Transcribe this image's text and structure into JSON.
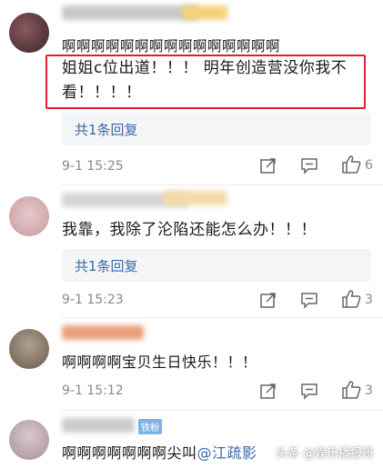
{
  "comments": [
    {
      "body_line1": "啊啊啊啊啊啊啊啊啊啊啊啊啊啊啊",
      "body_line2": "姐姐c位出道！！！ 明年创造营没你我不",
      "body_line3": "看！！！！",
      "reply_label": "共1条回复",
      "time": "9-1 15:25",
      "likes": "6"
    },
    {
      "body": "我靠，我除了沦陷还能怎么办！！！",
      "reply_label": "共1条回复",
      "time": "9-1 15:23",
      "likes": "3"
    },
    {
      "body": "啊啊啊啊宝贝生日快乐！！！",
      "time": "9-1 15:12",
      "likes": "3"
    },
    {
      "badge": "铁粉",
      "body_prefix": "啊啊啊啊啊啊啊尖叫",
      "body_mention": "@江疏影"
    }
  ],
  "watermark": "头条 @娱乐播报哥",
  "icons": {
    "share": "share-icon",
    "comment": "comment-icon",
    "like": "thumbs-up-icon"
  },
  "colors": {
    "highlight": "#e0202e",
    "link": "#3a6aa8"
  }
}
